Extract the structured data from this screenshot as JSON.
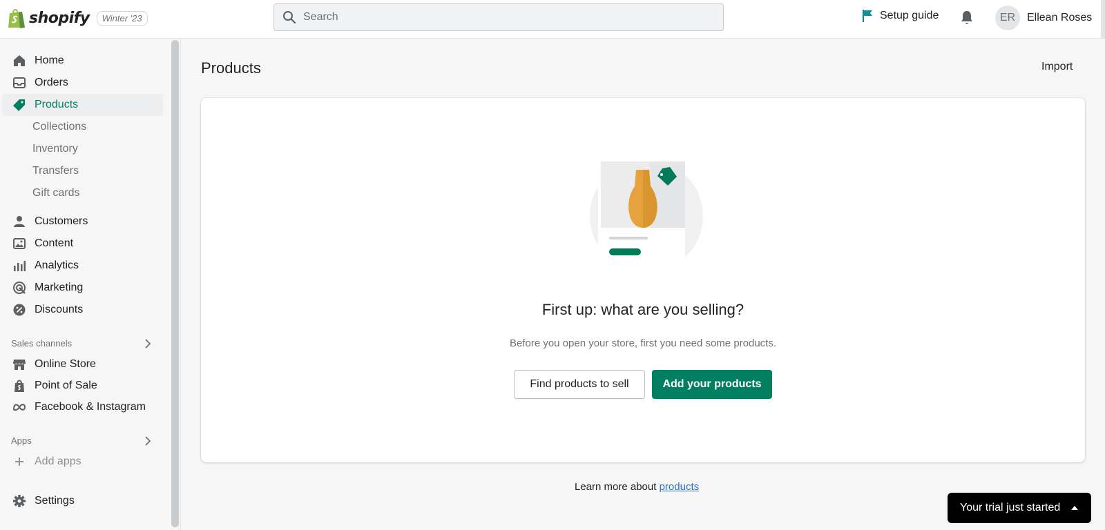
{
  "header": {
    "brand": "shopify",
    "edition": "Winter '23",
    "search_placeholder": "Search",
    "setup_guide": "Setup guide",
    "user_initials": "ER",
    "user_name": "Ellean Roses"
  },
  "sidebar": {
    "items": [
      {
        "label": "Home",
        "icon": "home-icon"
      },
      {
        "label": "Orders",
        "icon": "inbox-icon"
      },
      {
        "label": "Products",
        "icon": "tag-icon",
        "active": true
      },
      {
        "label": "Customers",
        "icon": "person-icon"
      },
      {
        "label": "Content",
        "icon": "image-icon"
      },
      {
        "label": "Analytics",
        "icon": "bar-chart-icon"
      },
      {
        "label": "Marketing",
        "icon": "target-icon"
      },
      {
        "label": "Discounts",
        "icon": "discount-icon"
      }
    ],
    "product_subitems": [
      "Collections",
      "Inventory",
      "Transfers",
      "Gift cards"
    ],
    "sales_channels_label": "Sales channels",
    "sales_channels": [
      {
        "label": "Online Store",
        "icon": "store-icon"
      },
      {
        "label": "Point of Sale",
        "icon": "pos-bag-icon"
      },
      {
        "label": "Facebook & Instagram",
        "icon": "meta-icon"
      }
    ],
    "apps_label": "Apps",
    "add_apps": "Add apps",
    "settings": "Settings"
  },
  "main": {
    "title": "Products",
    "import": "Import",
    "empty_heading": "First up: what are you selling?",
    "empty_sub": "Before you open your store, first you need some products.",
    "secondary_button": "Find products to sell",
    "primary_button": "Add your products",
    "learn_prefix": "Learn more about ",
    "learn_link": "products"
  },
  "trial_banner": "Your trial just started",
  "colors": {
    "accent": "#008060",
    "link": "#2c6ecb",
    "vase": "#e6a23c",
    "background": "#f6f6f7"
  }
}
